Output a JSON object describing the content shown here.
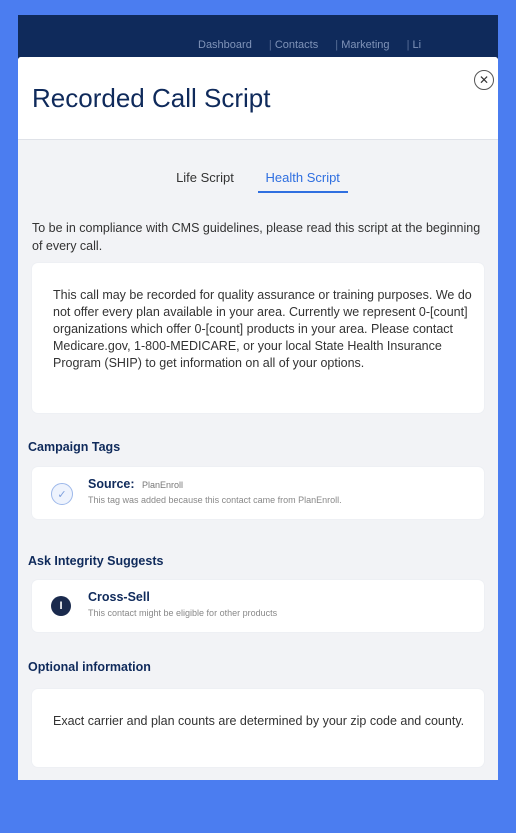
{
  "nav": {
    "items": [
      "Dashboard",
      "Contacts",
      "Marketing",
      "Li"
    ]
  },
  "modal": {
    "title": "Recorded Call Script",
    "close_icon": "close-circle-icon"
  },
  "tabs": [
    {
      "label": "Life Script",
      "active": false
    },
    {
      "label": "Health Script",
      "active": true
    }
  ],
  "intro": "To be in compliance with CMS guidelines, please read this script at the beginning of every call.",
  "script_text": "This call may be recorded for quality assurance or training purposes. We do not offer every plan available in your area. Currently we represent 0-[count] organizations which offer 0-[count] products in your area. Please contact Medicare.gov, 1-800-MEDICARE, or your local State Health Insurance Program (SHIP) to get information on all of your options.",
  "campaign_tags": {
    "heading": "Campaign Tags",
    "tag": {
      "label": "Source:",
      "value": "PlanEnroll",
      "description": "This tag was added because this contact came from PlanEnroll.",
      "icon": "checkmark-badge-icon"
    }
  },
  "ask_integrity": {
    "heading": "Ask Integrity Suggests",
    "suggestion": {
      "title": "Cross-Sell",
      "description": "This contact might be eligible for other products",
      "icon": "integrity-logo-icon"
    }
  },
  "optional": {
    "heading": "Optional information",
    "text": "Exact carrier and plan counts are determined by your zip code and county."
  },
  "colors": {
    "background": "#4b7df0",
    "nav": "#0f2a5b",
    "accent": "#2f6fe0",
    "heading": "#0f2a5b"
  }
}
